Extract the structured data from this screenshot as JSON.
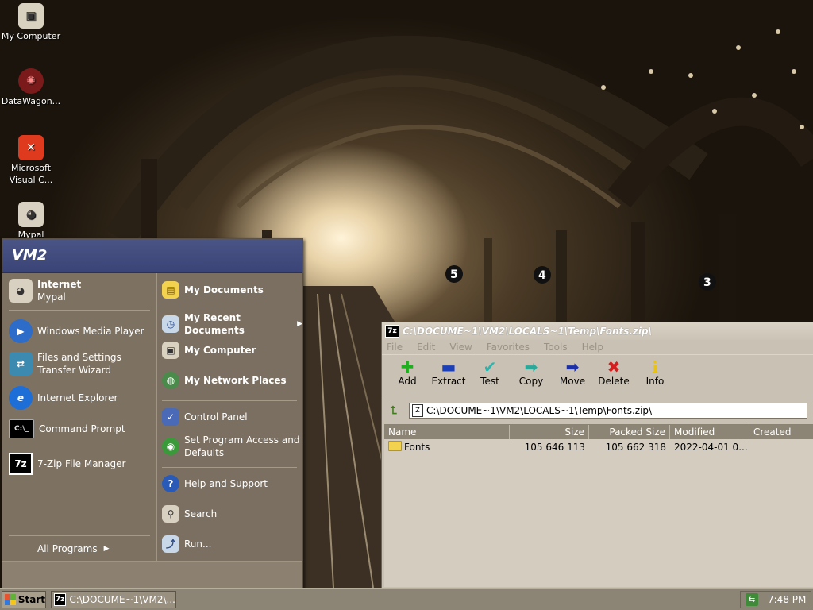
{
  "desktop": {
    "icons": [
      {
        "label": "My Computer",
        "icon": "computer-icon"
      },
      {
        "label": "DataWagon...",
        "icon": "datawagon-icon"
      },
      {
        "label_line1": "Microsoft",
        "label_line2": "Visual C...",
        "icon": "visual-c-icon"
      },
      {
        "label": "Mypal",
        "icon": "mypal-icon"
      }
    ]
  },
  "start_menu": {
    "user": "VM2",
    "left": {
      "pinned": {
        "title": "Internet",
        "subtitle": "Mypal"
      },
      "items": [
        {
          "label": "Windows Media Player"
        },
        {
          "label_line1": "Files and Settings",
          "label_line2": "Transfer Wizard"
        },
        {
          "label": "Internet Explorer"
        },
        {
          "label": "Command Prompt"
        },
        {
          "label": "7-Zip File Manager"
        }
      ],
      "all_programs": "All Programs"
    },
    "right": {
      "items": [
        {
          "label": "My Documents"
        },
        {
          "label": "My Recent Documents"
        },
        {
          "label": "My Computer"
        },
        {
          "label": "My Network Places"
        },
        {
          "label": "Control Panel"
        },
        {
          "label_line1": "Set Program Access and",
          "label_line2": "Defaults"
        },
        {
          "label": "Help and Support"
        },
        {
          "label": "Search"
        },
        {
          "label": "Run..."
        }
      ]
    }
  },
  "zip_window": {
    "title": "C:\\DOCUME~1\\VM2\\LOCALS~1\\Temp\\Fonts.zip\\",
    "menu": [
      "File",
      "Edit",
      "View",
      "Favorites",
      "Tools",
      "Help"
    ],
    "toolbar": [
      {
        "label": "Add",
        "icon": "add-icon",
        "glyph": "✚",
        "color": "#1fae1f"
      },
      {
        "label": "Extract",
        "icon": "extract-icon",
        "glyph": "▬",
        "color": "#1b3fb8"
      },
      {
        "label": "Test",
        "icon": "test-icon",
        "glyph": "✔",
        "color": "#27b6b0"
      },
      {
        "label": "Copy",
        "icon": "copy-icon",
        "glyph": "➡",
        "color": "#2aa89a"
      },
      {
        "label": "Move",
        "icon": "move-icon",
        "glyph": "➡",
        "color": "#1b2fa8"
      },
      {
        "label": "Delete",
        "icon": "delete-icon",
        "glyph": "✖",
        "color": "#d21f1f"
      },
      {
        "label": "Info",
        "icon": "info-icon",
        "glyph": "i",
        "color": "#e8c214"
      }
    ],
    "address": "C:\\DOCUME~1\\VM2\\LOCALS~1\\Temp\\Fonts.zip\\",
    "columns": [
      "Name",
      "Size",
      "Packed Size",
      "Modified",
      "Created"
    ],
    "rows": [
      {
        "name": "Fonts",
        "size": "105 646 113",
        "packed_size": "105 662 318",
        "modified": "2022-04-01 0...",
        "created": ""
      }
    ]
  },
  "taskbar": {
    "start_label": "Start",
    "task_label": "C:\\DOCUME~1\\VM2\\...",
    "clock": "7:48 PM"
  },
  "colors": {
    "start_header": "#3a4476",
    "menu_bg": "#7d7262",
    "window_bg": "#c9c1b3",
    "taskbar": "#8c8474"
  }
}
